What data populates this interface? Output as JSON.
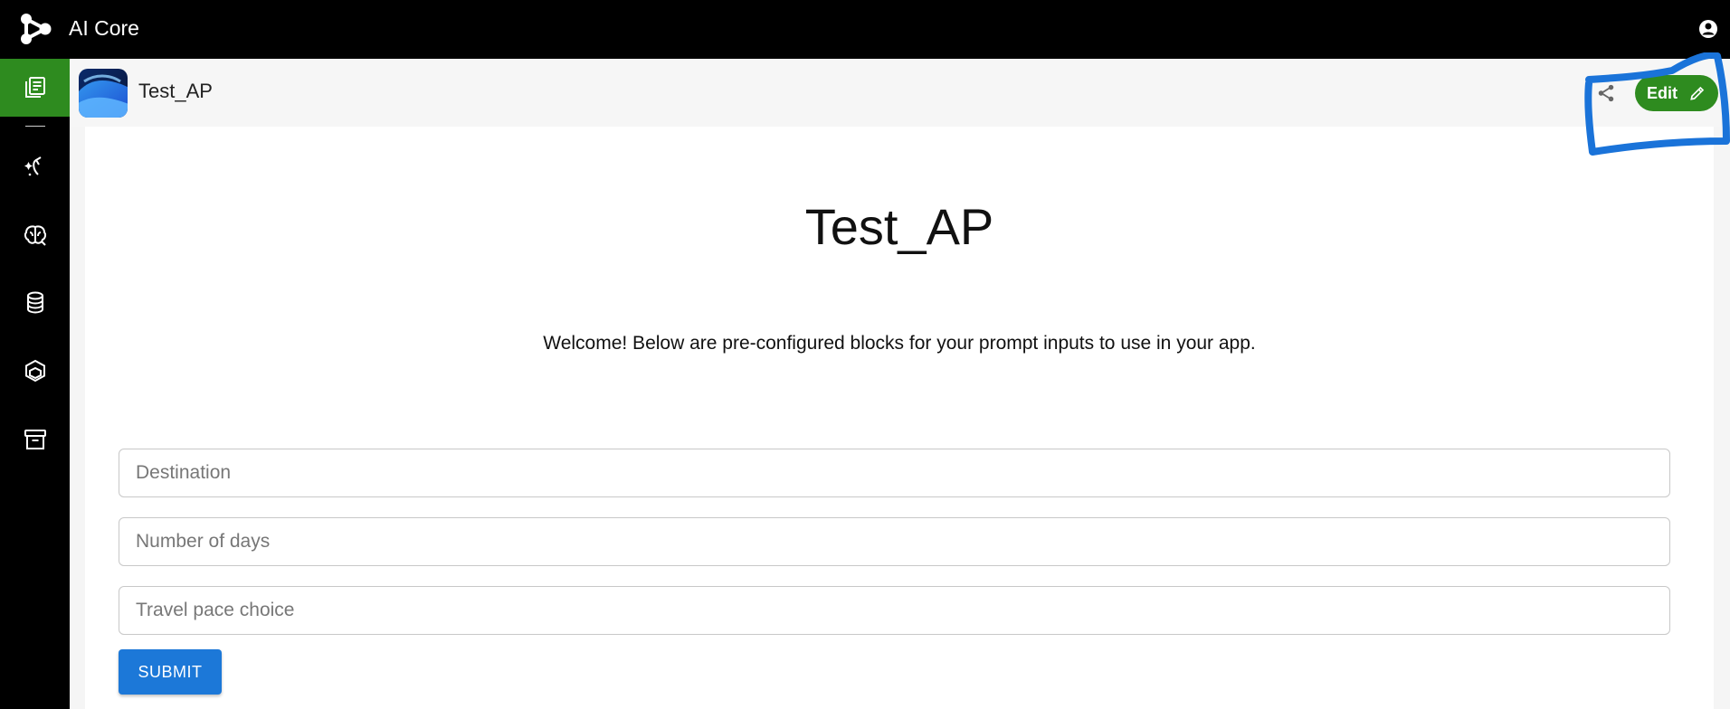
{
  "topbar": {
    "app_name": "AI Core",
    "logo_icon": "molecule-logo-icon",
    "user_icon": "account-circle-icon"
  },
  "sidebar": {
    "items": [
      {
        "name": "apps",
        "icon": "library-books-icon",
        "active": true
      },
      {
        "name": "prompts",
        "icon": "magic-wand-icon",
        "active": false
      },
      {
        "name": "models",
        "icon": "brain-icon",
        "active": false
      },
      {
        "name": "storage",
        "icon": "database-icon",
        "active": false
      },
      {
        "name": "functions",
        "icon": "cube-icon",
        "active": false
      },
      {
        "name": "archive",
        "icon": "archive-box-icon",
        "active": false
      }
    ],
    "active_color": "#2e8b1f"
  },
  "header": {
    "title": "Test_AP",
    "share_icon": "share-icon",
    "edit_label": "Edit",
    "edit_icon": "pencil-icon"
  },
  "content": {
    "title": "Test_AP",
    "welcome": "Welcome! Below are pre-configured blocks for your prompt inputs to use in your app.",
    "fields": [
      {
        "placeholder": "Destination",
        "value": ""
      },
      {
        "placeholder": "Number of days",
        "value": ""
      },
      {
        "placeholder": "Travel pace choice",
        "value": ""
      }
    ],
    "submit_label": "SUBMIT"
  },
  "colors": {
    "accent_green": "#2e8b1f",
    "primary_blue": "#1c78d8",
    "annotation_blue": "#1a73d9"
  }
}
